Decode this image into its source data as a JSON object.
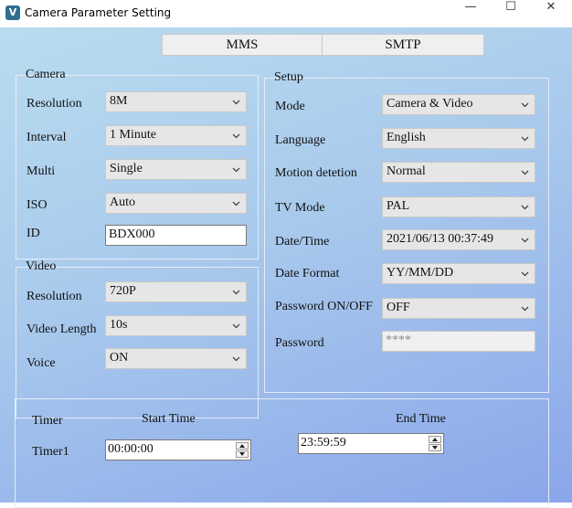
{
  "window": {
    "title": "Camera Parameter Setting",
    "icon_name": "camera-app-icon"
  },
  "window_controls": {
    "minimize": "—",
    "maximize": "☐",
    "close": "✕"
  },
  "tabs": [
    {
      "label": "MMS"
    },
    {
      "label": "SMTP"
    }
  ],
  "camera": {
    "legend": "Camera",
    "resolution": {
      "label": "Resolution",
      "value": "8M"
    },
    "interval": {
      "label": "Interval",
      "value": "1 Minute"
    },
    "multi": {
      "label": "Multi",
      "value": "Single"
    },
    "iso": {
      "label": "ISO",
      "value": "Auto"
    },
    "id": {
      "label": "ID",
      "value": "BDX000"
    }
  },
  "video": {
    "legend": "Video",
    "resolution": {
      "label": "Resolution",
      "value": "720P"
    },
    "video_length": {
      "label": "Video Length",
      "value": "10s"
    },
    "voice": {
      "label": "Voice",
      "value": "ON"
    }
  },
  "setup": {
    "legend": "Setup",
    "mode": {
      "label": "Mode",
      "value": "Camera & Video"
    },
    "language": {
      "label": "Language",
      "value": "English"
    },
    "motion": {
      "label": "Motion detetion",
      "value": "Normal"
    },
    "tv_mode": {
      "label": "TV Mode",
      "value": "PAL"
    },
    "datetime": {
      "label": "Date/Time",
      "value": "2021/06/13 00:37:49"
    },
    "date_format": {
      "label": "Date Format",
      "value": "YY/MM/DD"
    },
    "password_onoff": {
      "label": "Password ON/OFF",
      "value": "OFF"
    },
    "password": {
      "label": "Password",
      "value": "****"
    }
  },
  "timer": {
    "label": "Timer",
    "start_time_header": "Start Time",
    "end_time_header": "End Time",
    "timer1": {
      "label": "Timer1",
      "start": "00:00:00",
      "end": "23:59:59"
    }
  }
}
